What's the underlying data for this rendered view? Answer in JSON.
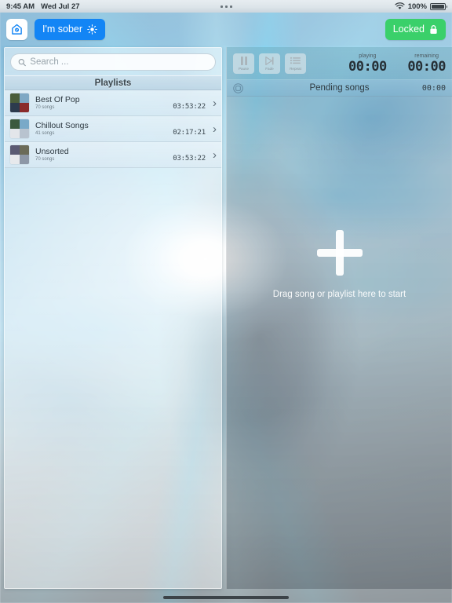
{
  "status_bar": {
    "time": "9:45 AM",
    "date": "Wed Jul 27",
    "battery_percent": "100%",
    "wifi_icon": "wifi-icon",
    "battery_icon": "battery-full-icon",
    "center_dots_icon": "three-dots-icon"
  },
  "toolbar": {
    "home_icon": "home-icon",
    "sober_label": "I'm sober",
    "sober_icon": "sun-icon",
    "lock_label": "Locked",
    "lock_icon": "lock-closed-icon",
    "accent_blue": "#1385f5",
    "accent_green": "#3ad06a"
  },
  "search": {
    "placeholder": "Search ...",
    "value": "",
    "icon": "search-icon"
  },
  "left_panel": {
    "header": "Playlists",
    "playlists": [
      {
        "name": "Best Of Pop",
        "count": "70 songs",
        "duration": "03:53:22",
        "chevron": "chevron-right-icon",
        "art": [
          "#4b5e3a",
          "#7fa8c4",
          "#2c3b4d",
          "#8a2b2b"
        ]
      },
      {
        "name": "Chillout Songs",
        "count": "41 songs",
        "duration": "02:17:21",
        "chevron": "chevron-right-icon",
        "art": [
          "#3b5a3e",
          "#79a9c8",
          "#e3e6ea",
          "#b8c3cf"
        ]
      },
      {
        "name": "Unsorted",
        "count": "70 songs",
        "duration": "03:53:22",
        "chevron": "chevron-right-icon",
        "art": [
          "#5a5a72",
          "#6b6b58",
          "#e7e9ec",
          "#8d97a6"
        ]
      }
    ]
  },
  "right_panel": {
    "transport": [
      {
        "label": "Pause",
        "icon": "pause-icon"
      },
      {
        "label": "Fade",
        "icon": "fade-next-icon"
      },
      {
        "label": "Repeat",
        "icon": "repeat-list-icon"
      }
    ],
    "timers": [
      {
        "label": "playing",
        "value": "00:00"
      },
      {
        "label": "remaining",
        "value": "00:00"
      }
    ],
    "pending": {
      "settings_icon": "circle-settings-icon",
      "title": "Pending songs",
      "time": "00:00"
    },
    "drop_zone": {
      "plus_icon": "plus-icon",
      "text": "Drag song or playlist here to start"
    }
  }
}
